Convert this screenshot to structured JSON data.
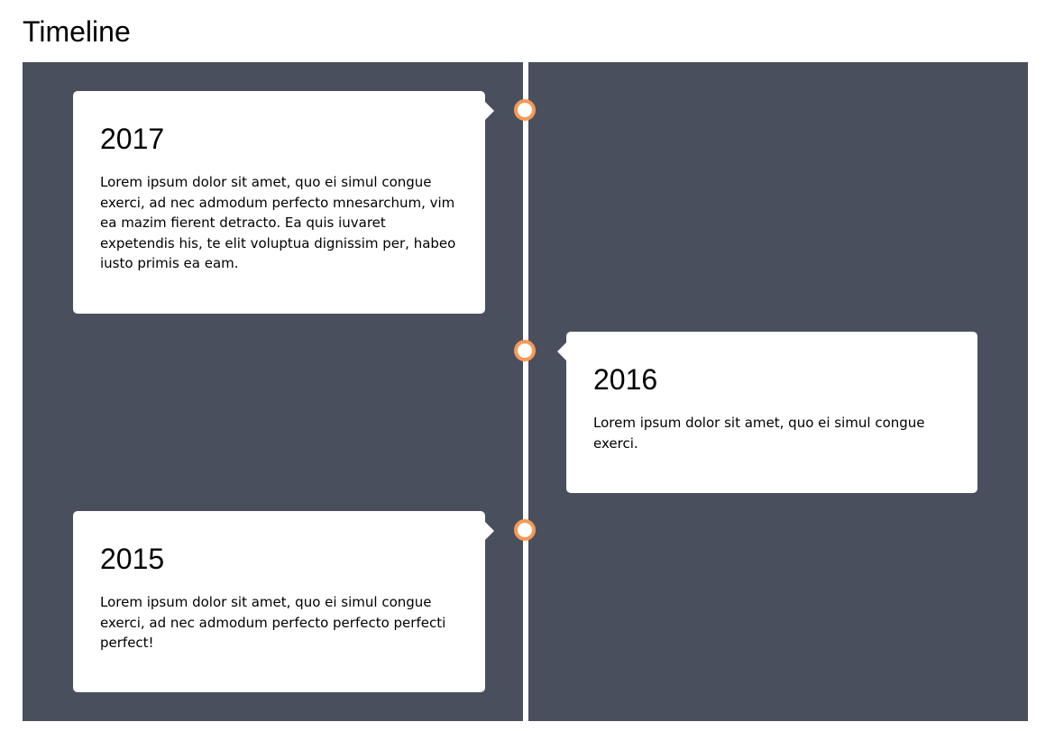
{
  "page": {
    "title": "Timeline"
  },
  "colors": {
    "timeline_background": "#4a4f5e",
    "timeline_line": "#ffffff",
    "dot_border": "#f59a55",
    "card_background": "#ffffff"
  },
  "timeline": {
    "entries": [
      {
        "year": "2017",
        "side": "left",
        "text": "Lorem ipsum dolor sit amet, quo ei simul congue exerci, ad nec admodum perfecto mnesarchum, vim ea mazim fierent detracto. Ea quis iuvaret expetendis his, te elit voluptua dignissim per, habeo iusto primis ea eam."
      },
      {
        "year": "2016",
        "side": "right",
        "text": "Lorem ipsum dolor sit amet, quo ei simul congue exerci."
      },
      {
        "year": "2015",
        "side": "left",
        "text": "Lorem ipsum dolor sit amet, quo ei simul congue exerci, ad nec admodum perfecto perfecto perfecti perfect!"
      }
    ]
  }
}
